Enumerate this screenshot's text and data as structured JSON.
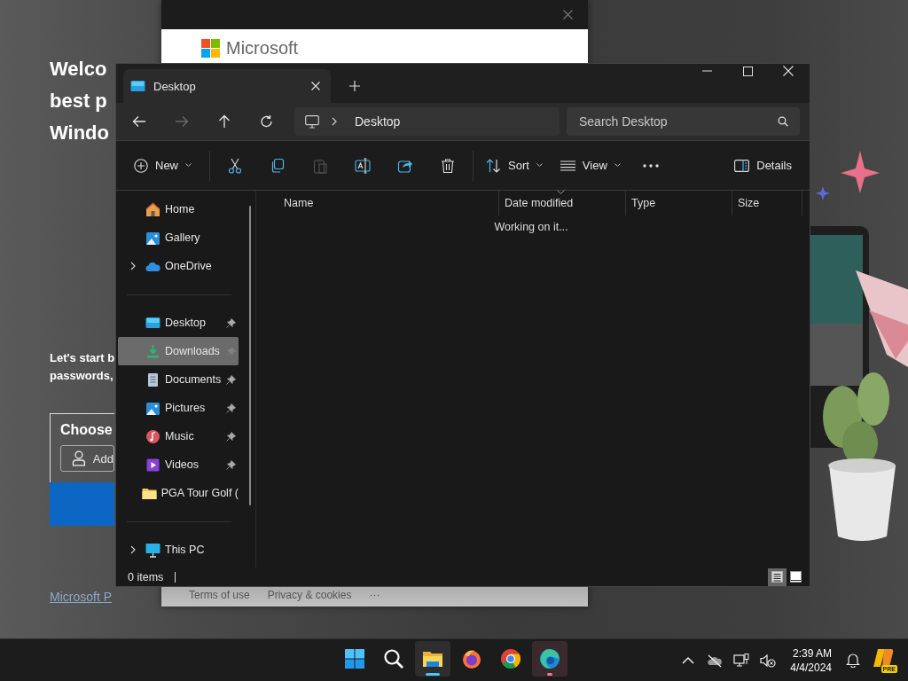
{
  "setup_page": {
    "heading_lines": [
      "Welco",
      "best p",
      "Windo"
    ],
    "intro_lines": [
      "Let's start b",
      "passwords,"
    ],
    "card_title": "Choose",
    "add_button": "Add",
    "footer_link": "Microsoft P"
  },
  "browser_window": {
    "brand": "Microsoft",
    "footer_links": [
      "Terms of use",
      "Privacy & cookies"
    ],
    "more": "···"
  },
  "explorer": {
    "tab": {
      "title": "Desktop"
    },
    "nav_buttons": [
      {
        "kind": "back",
        "disabled": false
      },
      {
        "kind": "forward",
        "disabled": true
      },
      {
        "kind": "up",
        "disabled": false
      },
      {
        "kind": "refresh",
        "disabled": false
      }
    ],
    "address": {
      "segments": [
        "Desktop"
      ]
    },
    "search": {
      "placeholder": "Search Desktop"
    },
    "toolbar": {
      "new_label": "New",
      "actions": [
        {
          "kind": "cut",
          "disabled": false
        },
        {
          "kind": "copy",
          "disabled": false
        },
        {
          "kind": "paste",
          "disabled": true
        },
        {
          "kind": "rename",
          "disabled": false
        },
        {
          "kind": "share",
          "disabled": false
        },
        {
          "kind": "delete",
          "disabled": false
        }
      ],
      "sort_label": "Sort",
      "view_label": "View",
      "details_label": "Details"
    },
    "sidebar": {
      "groups": [
        {
          "items": [
            {
              "label": "Home",
              "kind": "home",
              "expandable": false,
              "pinned": false,
              "selected": false
            },
            {
              "label": "Gallery",
              "kind": "gallery",
              "expandable": false,
              "pinned": false,
              "selected": false
            },
            {
              "label": "OneDrive",
              "kind": "cloud",
              "expandable": true,
              "pinned": false,
              "selected": false
            }
          ]
        },
        {
          "items": [
            {
              "label": "Desktop",
              "kind": "desktop",
              "expandable": false,
              "pinned": true,
              "selected": false
            },
            {
              "label": "Downloads",
              "kind": "downloads",
              "expandable": false,
              "pinned": true,
              "selected": true
            },
            {
              "label": "Documents",
              "kind": "documents",
              "expandable": false,
              "pinned": true,
              "selected": false
            },
            {
              "label": "Pictures",
              "kind": "pictures",
              "expandable": false,
              "pinned": true,
              "selected": false
            },
            {
              "label": "Music",
              "kind": "music",
              "expandable": false,
              "pinned": true,
              "selected": false
            },
            {
              "label": "Videos",
              "kind": "videos",
              "expandable": false,
              "pinned": true,
              "selected": false
            },
            {
              "label": "PGA Tour Golf (",
              "kind": "folder",
              "expandable": false,
              "pinned": false,
              "selected": false
            }
          ]
        },
        {
          "items": [
            {
              "label": "This PC",
              "kind": "pc",
              "expandable": true,
              "pinned": false,
              "selected": false
            }
          ]
        }
      ]
    },
    "columns": [
      {
        "label": "Name",
        "sorted": false
      },
      {
        "label": "Date modified",
        "sorted": true
      },
      {
        "label": "Type",
        "sorted": false
      },
      {
        "label": "Size",
        "sorted": false
      }
    ],
    "message": "Working on it...",
    "status": "0 items",
    "view_buttons": [
      {
        "kind": "details",
        "selected": true
      },
      {
        "kind": "tiles",
        "selected": false
      }
    ]
  },
  "taskbar": {
    "apps": [
      {
        "kind": "start",
        "selected": false,
        "attention": false
      },
      {
        "kind": "search",
        "selected": false,
        "attention": false
      },
      {
        "kind": "explorer",
        "selected": true,
        "attention": false
      },
      {
        "kind": "firefox",
        "selected": false,
        "attention": false
      },
      {
        "kind": "chrome",
        "selected": false,
        "attention": false
      },
      {
        "kind": "edge",
        "selected": false,
        "attention": true
      }
    ],
    "tray": [
      {
        "kind": "chevron"
      },
      {
        "kind": "cloud_off"
      },
      {
        "kind": "network"
      },
      {
        "kind": "volume_muted"
      }
    ],
    "time": "2:39 AM",
    "date": "4/4/2024",
    "copilot_badge": "PRE"
  }
}
